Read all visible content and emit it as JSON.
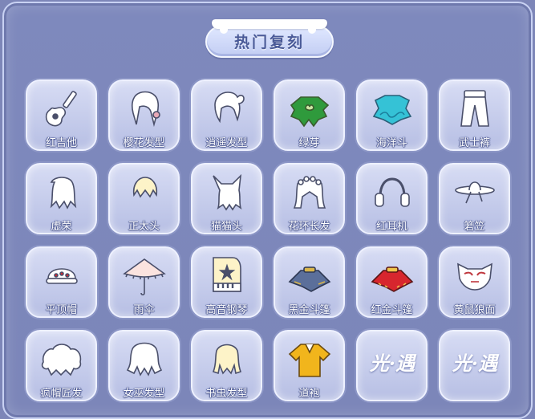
{
  "header": {
    "title": "热门复刻"
  },
  "items": [
    {
      "label": "红吉他",
      "icon": "guitar-icon"
    },
    {
      "label": "樱花发型",
      "icon": "sakura-hairstyle-icon"
    },
    {
      "label": "逍遥发型",
      "icon": "carefree-hairstyle-icon"
    },
    {
      "label": "绿芽",
      "icon": "green-sprout-icon"
    },
    {
      "label": "海洋斗",
      "icon": "ocean-cape-icon"
    },
    {
      "label": "武士裤",
      "icon": "samurai-pants-icon"
    },
    {
      "label": "虚荣",
      "icon": "vanity-hair-icon"
    },
    {
      "label": "正太头",
      "icon": "boy-hair-icon"
    },
    {
      "label": "猫猫头",
      "icon": "cat-ears-hair-icon"
    },
    {
      "label": "花环长发",
      "icon": "flower-crown-hair-icon"
    },
    {
      "label": "红耳机",
      "icon": "headphones-icon"
    },
    {
      "label": "箬笠",
      "icon": "bamboo-hat-icon"
    },
    {
      "label": "平顶帽",
      "icon": "flat-cap-icon"
    },
    {
      "label": "雨伞",
      "icon": "umbrella-icon"
    },
    {
      "label": "高音钢琴",
      "icon": "piano-icon"
    },
    {
      "label": "黑金斗篷",
      "icon": "black-gold-cape-icon"
    },
    {
      "label": "红金斗篷",
      "icon": "red-gold-cape-icon"
    },
    {
      "label": "黄鼠狼面",
      "icon": "weasel-mask-icon"
    },
    {
      "label": "疯帽匠发",
      "icon": "mad-hatter-hair-icon"
    },
    {
      "label": "女巫发型",
      "icon": "witch-hair-icon"
    },
    {
      "label": "书虫发型",
      "icon": "bookworm-hair-icon"
    },
    {
      "label": "道袍",
      "icon": "taoist-robe-icon"
    },
    {
      "label": "",
      "icon": "sky-logo-icon",
      "logo_text": "光·遇"
    },
    {
      "label": "",
      "icon": "sky-logo-icon",
      "logo_text": "光·遇"
    }
  ],
  "colors": {
    "background": "#7d86b8",
    "tile": "#c9d0ee",
    "title_text": "#4a5a98",
    "green_cape": "#2f9a3c",
    "ocean_cape": "#35c2d6",
    "black_gold_cape": "#5b6f9a",
    "red_gold_cape": "#d7262e",
    "robe": "#f1b51c"
  }
}
